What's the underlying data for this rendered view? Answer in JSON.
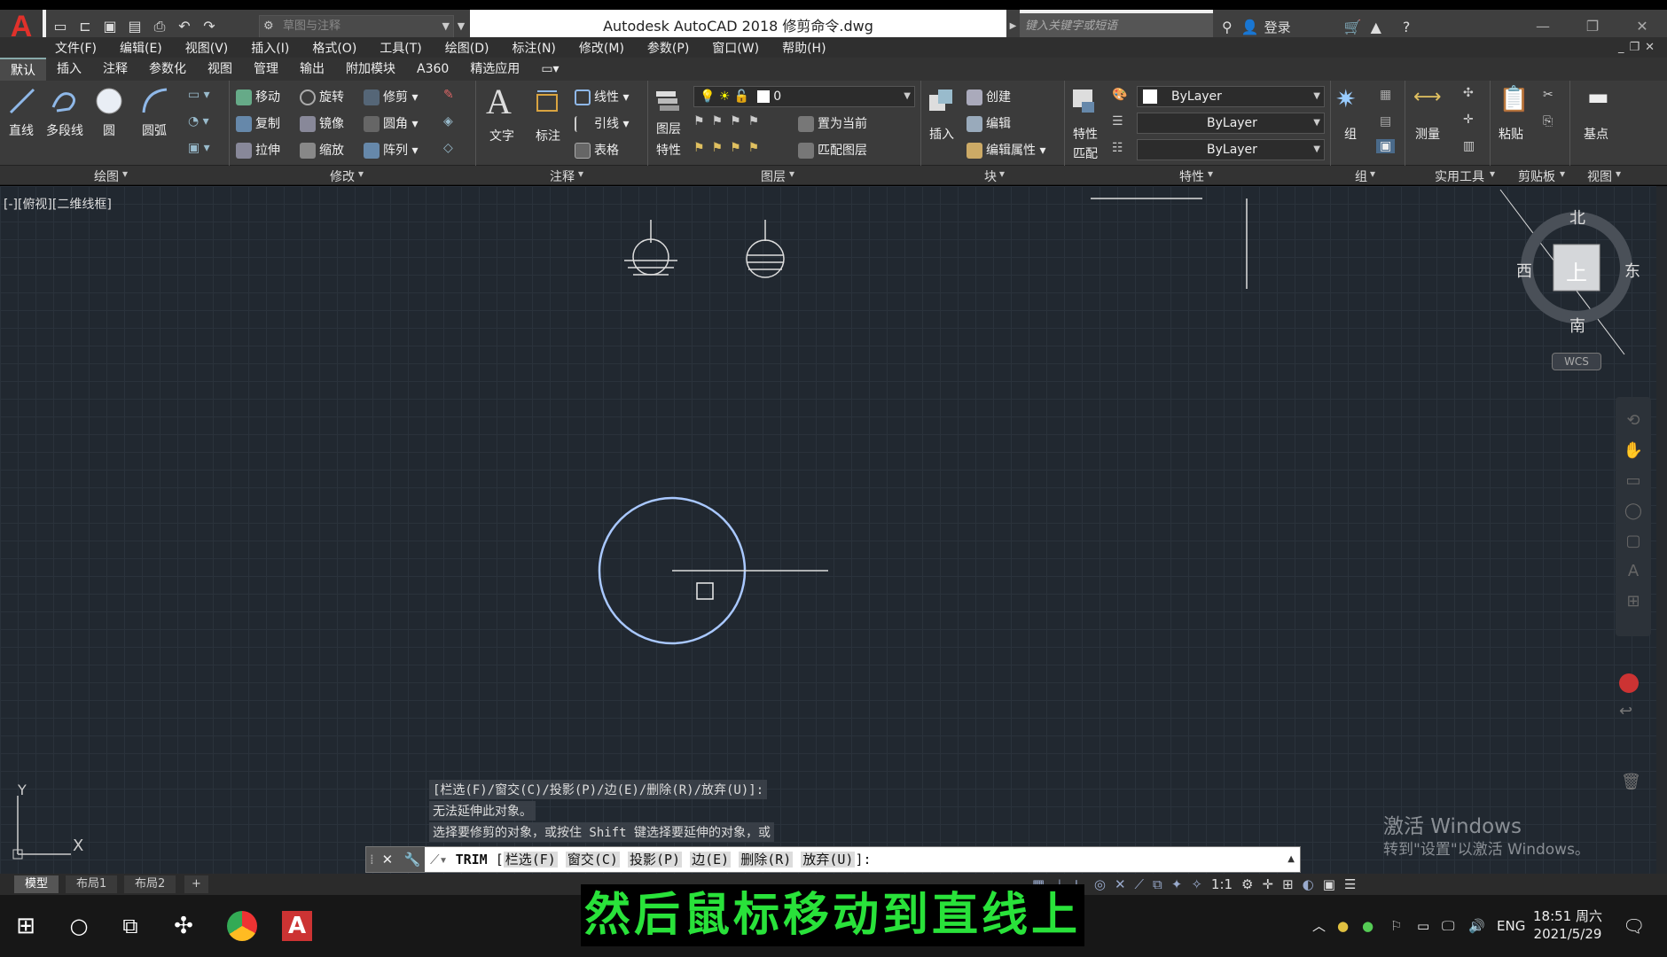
{
  "titlebar": {
    "logo": "A",
    "workspace_placeholder": "草图与注释",
    "app_title": "Autodesk AutoCAD 2018    修剪命令.dwg",
    "search_placeholder": "键入关键字或短语",
    "login": "登录"
  },
  "menu": [
    "文件(F)",
    "编辑(E)",
    "视图(V)",
    "插入(I)",
    "格式(O)",
    "工具(T)",
    "绘图(D)",
    "标注(N)",
    "修改(M)",
    "参数(P)",
    "窗口(W)",
    "帮助(H)"
  ],
  "ribbon_tabs": [
    "默认",
    "插入",
    "注释",
    "参数化",
    "视图",
    "管理",
    "输出",
    "附加模块",
    "A360",
    "精选应用"
  ],
  "ribbon": {
    "draw": {
      "line": "直线",
      "polyline": "多段线",
      "circle": "圆",
      "arc": "圆弧"
    },
    "modify": {
      "move": "移动",
      "rotate": "旋转",
      "trim": "修剪",
      "copy": "复制",
      "mirror": "镜像",
      "fillet": "圆角",
      "stretch": "拉伸",
      "scale": "缩放",
      "array": "阵列"
    },
    "annotation": {
      "text": "文字",
      "dimension": "标注",
      "linear": "线性",
      "leader": "引线",
      "table": "表格"
    },
    "layers": {
      "layer_props_1": "图层",
      "layer_props_2": "特性",
      "current_layer": "0",
      "set_current": "置为当前",
      "match_layer": "匹配图层"
    },
    "block": {
      "insert": "插入",
      "create": "创建",
      "edit": "编辑",
      "edit_attr": "编辑属性"
    },
    "properties": {
      "match_1": "特性",
      "match_2": "匹配",
      "color": "ByLayer",
      "linetype": "ByLayer",
      "lineweight": "ByLayer"
    },
    "group": "组",
    "utilities": "测量",
    "clipboard": "粘贴",
    "basepoint": "基点",
    "panel_titles": [
      "绘图",
      "修改",
      "注释",
      "图层",
      "块",
      "特性",
      "组",
      "实用工具",
      "剪贴板",
      "视图"
    ]
  },
  "viewport": {
    "label": "[-][俯视][二维线框]",
    "compass": {
      "n": "北",
      "s": "南",
      "e": "东",
      "w": "西",
      "top": "上",
      "wcs": "WCS"
    },
    "ucs_x": "X",
    "ucs_y": "Y"
  },
  "command": {
    "history": [
      "[栏选(F)/窗交(C)/投影(P)/边(E)/删除(R)/放弃(U)]:",
      "无法延伸此对象。",
      "选择要修剪的对象，或按住 Shift 键选择要延伸的对象，或"
    ],
    "prompt_cmd": "TRIM",
    "options": [
      "栏选(F)",
      "窗交(C)",
      "投影(P)",
      "边(E)",
      "删除(R)",
      "放弃(U)"
    ],
    "bracket_open": "[",
    "bracket_close": "]:"
  },
  "layout_tabs": [
    "模型",
    "布局1",
    "布局2",
    "+"
  ],
  "status": {
    "scale": "1:1"
  },
  "activation": {
    "line1": "激活 Windows",
    "line2": "转到\"设置\"以激活 Windows。"
  },
  "subtitle": "然后鼠标移动到直线上",
  "taskbar": {
    "lang": "ENG",
    "time": "18:51 周六",
    "date": "2021/5/29"
  },
  "colors": {
    "circle": "#a9c8ff",
    "subtitle": "#29e23a",
    "canvas": "#212830"
  }
}
